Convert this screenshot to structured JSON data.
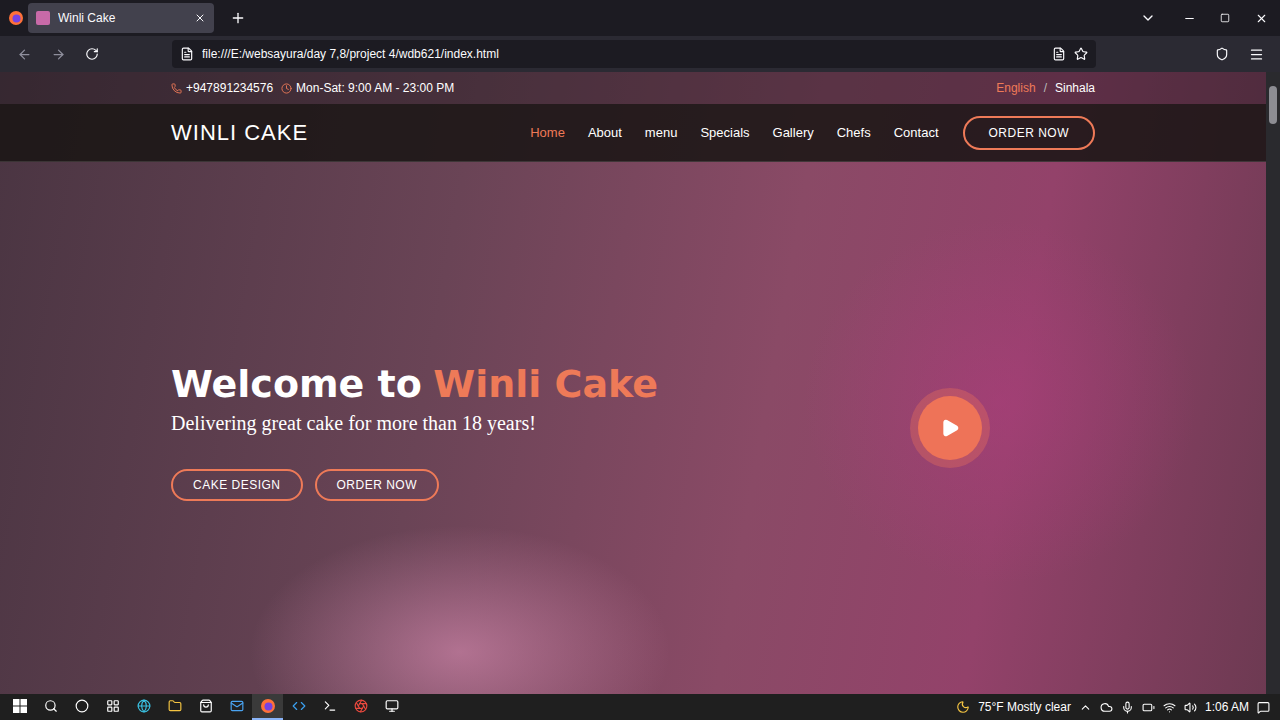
{
  "browser": {
    "tabs": [
      {
        "title": "Winli Cake",
        "selected": true
      }
    ],
    "url": "file:///E:/websayura/day 7,8/project 4/wdb621/index.html"
  },
  "topbar": {
    "phone": "+947891234576",
    "hours": "Mon-Sat: 9:00 AM - 23:00 PM",
    "separator": "/",
    "languages": [
      {
        "label": "English",
        "selected": true
      },
      {
        "label": "Sinhala",
        "selected": false
      }
    ]
  },
  "nav": {
    "logo": "WINLI CAKE",
    "items": [
      {
        "label": "Home",
        "selected": true
      },
      {
        "label": "About",
        "selected": false
      },
      {
        "label": "menu",
        "selected": false
      },
      {
        "label": "Specials",
        "selected": false
      },
      {
        "label": "Gallery",
        "selected": false
      },
      {
        "label": "Chefs",
        "selected": false
      },
      {
        "label": "Contact",
        "selected": false
      }
    ],
    "cta": "ORDER NOW"
  },
  "hero": {
    "title": "Welcome to",
    "highlight": "Winli Cake",
    "subtitle": "Delivering great cake for more than 18 years!",
    "buttons": [
      "CAKE DESIGN",
      "ORDER NOW"
    ]
  },
  "taskbar": {
    "weather": "75°F Mostly clear",
    "time": "1:06 AM"
  }
}
